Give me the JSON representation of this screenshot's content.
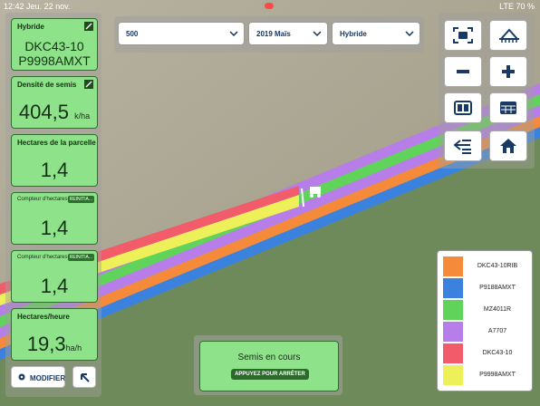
{
  "status_bar": {
    "time": "12:42",
    "date": "Jeu. 22 nov.",
    "network": "LTE",
    "battery": "70 %"
  },
  "cards": {
    "hybride": {
      "title": "Hybride",
      "line1": "DKC43-10",
      "line2": "P9998AMXT"
    },
    "densite": {
      "title": "Densité de semis",
      "value": "404,5",
      "unit": "k/ha"
    },
    "hectares_parcelle": {
      "title": "Hectares de la parcelle",
      "value": "1,4"
    },
    "compteur_a": {
      "title": "Compteur d'hectares A",
      "badge": "REINITIA...",
      "value": "1,4"
    },
    "compteur_b": {
      "title": "Compteur d'hectares B",
      "badge": "REINITIA...",
      "value": "1,4"
    },
    "hectares_heure": {
      "title": "Hectares/heure",
      "value": "19,3",
      "unit": "ha/h"
    }
  },
  "buttons": {
    "modifier": "MODIFIER"
  },
  "selectors": {
    "field": "500",
    "season": "2019 Maïs",
    "layer": "Hybride"
  },
  "control_icons": [
    "fullscreen-icon",
    "planter-icon",
    "zoom-out-icon",
    "zoom-in-icon",
    "split-view-icon",
    "table-icon",
    "layers-back-icon",
    "home-icon"
  ],
  "legend": [
    {
      "label": "DKC43-10RIB",
      "color": "#f58a3a"
    },
    {
      "label": "P9188AMXT",
      "color": "#3a82de"
    },
    {
      "label": "MZ4011R",
      "color": "#5fd35a"
    },
    {
      "label": "A7707",
      "color": "#b77de8"
    },
    {
      "label": "DKC43-10",
      "color": "#f25c6a"
    },
    {
      "label": "P9998AMXT",
      "color": "#eef05a"
    }
  ],
  "planting_status": {
    "title": "Semis en cours",
    "stop_label": "APPUYEZ POUR ARRÊTER"
  }
}
